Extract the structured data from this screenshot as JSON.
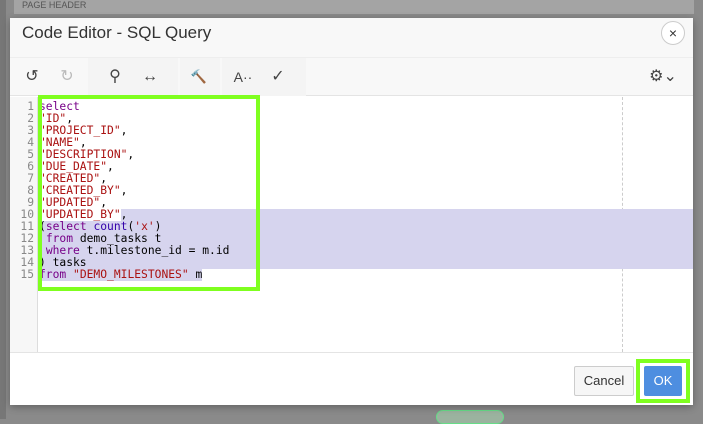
{
  "background": {
    "page_header": "PAGE HEADER"
  },
  "dialog": {
    "title": "Code Editor - SQL Query",
    "close_icon": "×"
  },
  "toolbar": {
    "undo": "↺",
    "redo": "↻",
    "search": "⚲",
    "replace": "↔",
    "build": "🔨",
    "font": "A··",
    "validate": "✓",
    "settings": "⚙⌄"
  },
  "editor": {
    "line_numbers": [
      "1",
      "2",
      "3",
      "4",
      "5",
      "6",
      "7",
      "8",
      "9",
      "10",
      "11",
      "12",
      "13",
      "14",
      "15"
    ],
    "lines": [
      [
        [
          "select",
          "kw"
        ]
      ],
      [
        [
          "\"ID\"",
          "str"
        ],
        [
          ",",
          "pl"
        ]
      ],
      [
        [
          "\"PROJECT_ID\"",
          "str"
        ],
        [
          ",",
          "pl"
        ]
      ],
      [
        [
          "\"NAME\"",
          "str"
        ],
        [
          ",",
          "pl"
        ]
      ],
      [
        [
          "\"DESCRIPTION\"",
          "str"
        ],
        [
          ",",
          "pl"
        ]
      ],
      [
        [
          "\"DUE_DATE\"",
          "str"
        ],
        [
          ",",
          "pl"
        ]
      ],
      [
        [
          "\"CREATED\"",
          "str"
        ],
        [
          ",",
          "pl"
        ]
      ],
      [
        [
          "\"CREATED_BY\"",
          "str"
        ],
        [
          ",",
          "pl"
        ]
      ],
      [
        [
          "\"UPDATED\"",
          "str"
        ],
        [
          ",",
          "pl"
        ]
      ],
      [
        [
          "\"UPDATED_BY\"",
          "str"
        ],
        [
          ",",
          "pl"
        ]
      ],
      [
        [
          "(",
          "pl"
        ],
        [
          "select",
          "kw"
        ],
        [
          " ",
          "pl"
        ],
        [
          "count",
          "fn"
        ],
        [
          "(",
          "pl"
        ],
        [
          "'x'",
          "str"
        ],
        [
          ")",
          "pl"
        ]
      ],
      [
        [
          " ",
          "pl"
        ],
        [
          "from",
          "kw"
        ],
        [
          " demo_tasks t",
          "pl"
        ]
      ],
      [
        [
          " ",
          "pl"
        ],
        [
          "where",
          "kw"
        ],
        [
          " t.milestone_id = m.id",
          "pl"
        ]
      ],
      [
        [
          ") tasks",
          "pl"
        ]
      ],
      [
        [
          "from",
          "kw"
        ],
        [
          " ",
          "pl"
        ],
        [
          "\"DEMO_MILESTONES\"",
          "str"
        ],
        [
          " m",
          "pl"
        ]
      ]
    ]
  },
  "footer": {
    "cancel": "Cancel",
    "ok": "OK"
  }
}
